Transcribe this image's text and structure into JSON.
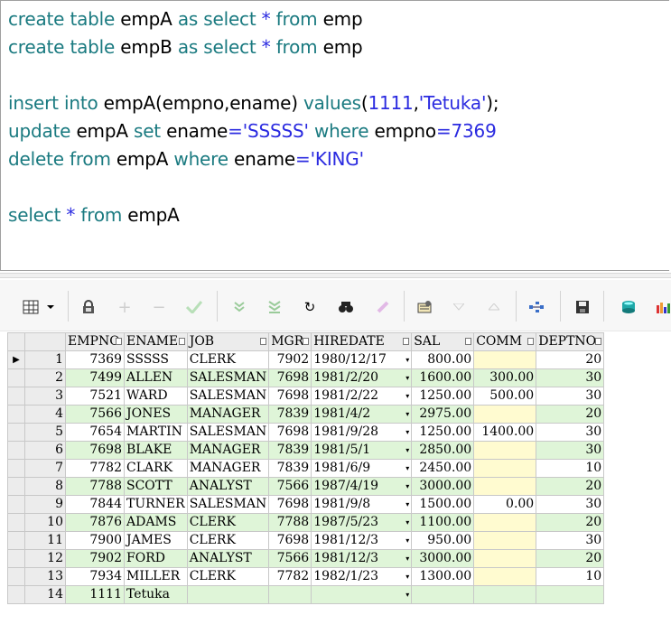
{
  "editor": {
    "lines": [
      {
        "tokens": [
          [
            "kw",
            "create"
          ],
          [
            "id",
            " "
          ],
          [
            "kw",
            "table"
          ],
          [
            "id",
            " empA "
          ],
          [
            "kw",
            "as"
          ],
          [
            "id",
            " "
          ],
          [
            "kw",
            "select"
          ],
          [
            "id",
            " "
          ],
          [
            "star",
            "*"
          ],
          [
            "id",
            " "
          ],
          [
            "kw",
            "from"
          ],
          [
            "id",
            " emp"
          ]
        ]
      },
      {
        "tokens": [
          [
            "kw",
            "create"
          ],
          [
            "id",
            " "
          ],
          [
            "kw",
            "table"
          ],
          [
            "id",
            " empB "
          ],
          [
            "kw",
            "as"
          ],
          [
            "id",
            " "
          ],
          [
            "kw",
            "select"
          ],
          [
            "id",
            " "
          ],
          [
            "star",
            "*"
          ],
          [
            "id",
            " "
          ],
          [
            "kw",
            "from"
          ],
          [
            "id",
            " emp"
          ]
        ]
      },
      {
        "tokens": []
      },
      {
        "tokens": [
          [
            "kw",
            "insert"
          ],
          [
            "id",
            " "
          ],
          [
            "kw",
            "into"
          ],
          [
            "id",
            " empA(empno,ename) "
          ],
          [
            "kw",
            "values"
          ],
          [
            "id",
            "("
          ],
          [
            "num",
            "1111"
          ],
          [
            "id",
            ","
          ],
          [
            "str",
            "'Tetuka'"
          ],
          [
            "id",
            ");"
          ]
        ]
      },
      {
        "tokens": [
          [
            "kw",
            "update"
          ],
          [
            "id",
            " empA "
          ],
          [
            "kw",
            "set"
          ],
          [
            "id",
            " ename"
          ],
          [
            "op",
            "="
          ],
          [
            "str",
            "'SSSSS'"
          ],
          [
            "id",
            " "
          ],
          [
            "kw",
            "where"
          ],
          [
            "id",
            " empno"
          ],
          [
            "op",
            "="
          ],
          [
            "num",
            "7369"
          ]
        ]
      },
      {
        "tokens": [
          [
            "kw",
            "delete"
          ],
          [
            "id",
            " "
          ],
          [
            "kw",
            "from"
          ],
          [
            "id",
            " empA "
          ],
          [
            "kw",
            "where"
          ],
          [
            "id",
            " ename"
          ],
          [
            "op",
            "="
          ],
          [
            "str",
            "'KING'"
          ]
        ]
      },
      {
        "tokens": []
      },
      {
        "tokens": [
          [
            "kw",
            "select"
          ],
          [
            "id",
            " "
          ],
          [
            "star",
            "*"
          ],
          [
            "id",
            " "
          ],
          [
            "kw",
            "from"
          ],
          [
            "id",
            " empA"
          ]
        ]
      }
    ]
  },
  "toolbar": {
    "icons": [
      "grid-view-icon",
      "dropdown-arrow-icon",
      "lock-icon",
      "add-record-icon",
      "delete-record-icon",
      "post-changes-icon",
      "next-record-icon",
      "last-record-icon",
      "refresh-icon",
      "find-icon",
      "clear-icon",
      "query-by-example-icon",
      "sort-ascending-icon",
      "sort-descending-icon",
      "explain-plan-icon",
      "save-icon",
      "export-icon",
      "chart-icon"
    ]
  },
  "grid": {
    "columns": [
      "EMPNO",
      "ENAME",
      "JOB",
      "MGR",
      "HIREDATE",
      "SAL",
      "COMM",
      "DEPTNO"
    ],
    "current_row_marker": "▶",
    "rows": [
      {
        "n": "1",
        "empno": "7369",
        "ename": "SSSSS",
        "job": "CLERK",
        "mgr": "7902",
        "hiredate": "1980/12/17",
        "sal": "800.00",
        "comm": "",
        "deptno": "20"
      },
      {
        "n": "2",
        "empno": "7499",
        "ename": "ALLEN",
        "job": "SALESMAN",
        "mgr": "7698",
        "hiredate": "1981/2/20",
        "sal": "1600.00",
        "comm": "300.00",
        "deptno": "30"
      },
      {
        "n": "3",
        "empno": "7521",
        "ename": "WARD",
        "job": "SALESMAN",
        "mgr": "7698",
        "hiredate": "1981/2/22",
        "sal": "1250.00",
        "comm": "500.00",
        "deptno": "30"
      },
      {
        "n": "4",
        "empno": "7566",
        "ename": "JONES",
        "job": "MANAGER",
        "mgr": "7839",
        "hiredate": "1981/4/2",
        "sal": "2975.00",
        "comm": "",
        "deptno": "20"
      },
      {
        "n": "5",
        "empno": "7654",
        "ename": "MARTIN",
        "job": "SALESMAN",
        "mgr": "7698",
        "hiredate": "1981/9/28",
        "sal": "1250.00",
        "comm": "1400.00",
        "deptno": "30"
      },
      {
        "n": "6",
        "empno": "7698",
        "ename": "BLAKE",
        "job": "MANAGER",
        "mgr": "7839",
        "hiredate": "1981/5/1",
        "sal": "2850.00",
        "comm": "",
        "deptno": "30"
      },
      {
        "n": "7",
        "empno": "7782",
        "ename": "CLARK",
        "job": "MANAGER",
        "mgr": "7839",
        "hiredate": "1981/6/9",
        "sal": "2450.00",
        "comm": "",
        "deptno": "10"
      },
      {
        "n": "8",
        "empno": "7788",
        "ename": "SCOTT",
        "job": "ANALYST",
        "mgr": "7566",
        "hiredate": "1987/4/19",
        "sal": "3000.00",
        "comm": "",
        "deptno": "20"
      },
      {
        "n": "9",
        "empno": "7844",
        "ename": "TURNER",
        "job": "SALESMAN",
        "mgr": "7698",
        "hiredate": "1981/9/8",
        "sal": "1500.00",
        "comm": "0.00",
        "deptno": "30"
      },
      {
        "n": "10",
        "empno": "7876",
        "ename": "ADAMS",
        "job": "CLERK",
        "mgr": "7788",
        "hiredate": "1987/5/23",
        "sal": "1100.00",
        "comm": "",
        "deptno": "20"
      },
      {
        "n": "11",
        "empno": "7900",
        "ename": "JAMES",
        "job": "CLERK",
        "mgr": "7698",
        "hiredate": "1981/12/3",
        "sal": "950.00",
        "comm": "",
        "deptno": "30"
      },
      {
        "n": "12",
        "empno": "7902",
        "ename": "FORD",
        "job": "ANALYST",
        "mgr": "7566",
        "hiredate": "1981/12/3",
        "sal": "3000.00",
        "comm": "",
        "deptno": "20"
      },
      {
        "n": "13",
        "empno": "7934",
        "ename": "MILLER",
        "job": "CLERK",
        "mgr": "7782",
        "hiredate": "1982/1/23",
        "sal": "1300.00",
        "comm": "",
        "deptno": "10"
      },
      {
        "n": "14",
        "empno": "1111",
        "ename": "Tetuka",
        "job": "",
        "mgr": "",
        "hiredate": "",
        "sal": "",
        "comm": "",
        "deptno": ""
      }
    ]
  },
  "colors": {
    "keyword": "#1a7a80",
    "literal": "#2a2ae0",
    "row_even": "#dff5d8",
    "null_comm": "#fffbd0"
  }
}
